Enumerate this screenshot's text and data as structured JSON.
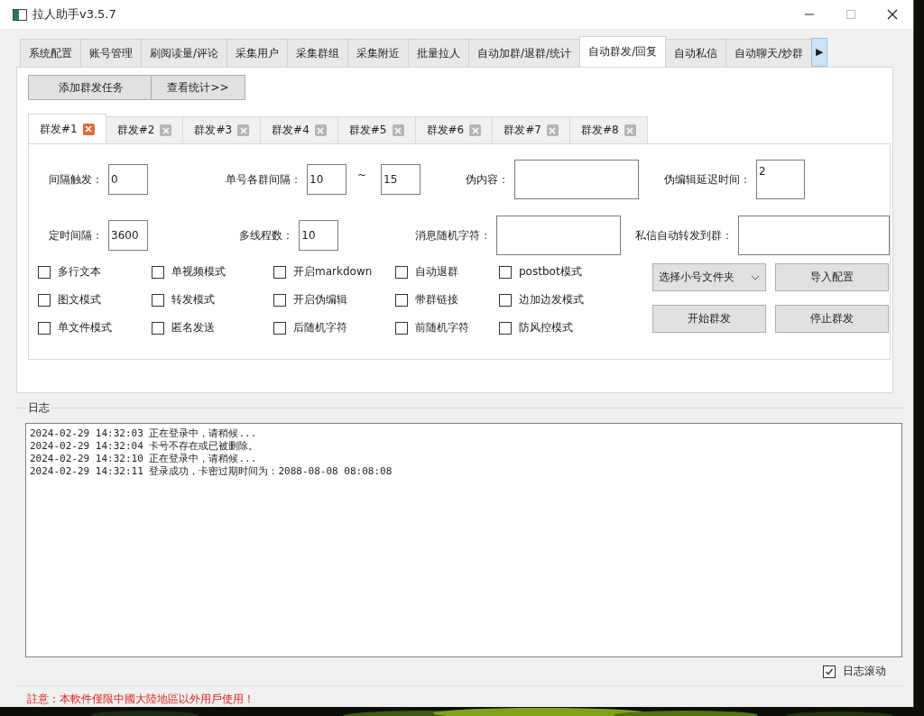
{
  "window": {
    "title": "拉人助手v3.5.7"
  },
  "main_tabs": [
    {
      "label": "系统配置",
      "selected": false
    },
    {
      "label": "账号管理",
      "selected": false
    },
    {
      "label": "刷阅读量/评论",
      "selected": false
    },
    {
      "label": "采集用户",
      "selected": false
    },
    {
      "label": "采集群组",
      "selected": false
    },
    {
      "label": "采集附近",
      "selected": false
    },
    {
      "label": "批量拉人",
      "selected": false
    },
    {
      "label": "自动加群/退群/统计",
      "selected": false
    },
    {
      "label": "自动群发/回复",
      "selected": true
    },
    {
      "label": "自动私信",
      "selected": false
    },
    {
      "label": "自动聊天/炒群",
      "selected": false
    }
  ],
  "tab_scroll": "▶",
  "top_buttons": [
    "添加群发任务",
    "查看统计>>"
  ],
  "sub_tabs": [
    {
      "label": "群发#1",
      "selected": true
    },
    {
      "label": "群发#2",
      "selected": false
    },
    {
      "label": "群发#3",
      "selected": false
    },
    {
      "label": "群发#4",
      "selected": false
    },
    {
      "label": "群发#5",
      "selected": false
    },
    {
      "label": "群发#6",
      "selected": false
    },
    {
      "label": "群发#7",
      "selected": false
    },
    {
      "label": "群发#8",
      "selected": false
    }
  ],
  "field_rows": [
    [
      {
        "kind": "short",
        "label": "间隔触发：",
        "value": "0"
      },
      {
        "kind": "range",
        "label": "单号各群间隔：",
        "from": "10",
        "separator": "~",
        "to": "15"
      },
      {
        "kind": "wide",
        "label": "伪内容："
      },
      {
        "kind": "tall",
        "label": "伪编辑延迟时间：",
        "value": "2"
      }
    ],
    [
      {
        "kind": "short",
        "label": "定时间隔：",
        "value": "3600"
      },
      {
        "kind": "single",
        "label": "多线程数：",
        "value": "10"
      },
      {
        "kind": "wide",
        "label": "消息随机字符："
      },
      {
        "kind": "long",
        "label": "私信自动转发到群："
      }
    ]
  ],
  "checkboxes": [
    {
      "label": "多行文本",
      "checked": false
    },
    {
      "label": "单视频模式",
      "checked": false
    },
    {
      "label": "开启markdown",
      "checked": false
    },
    {
      "label": "自动退群",
      "checked": false
    },
    {
      "label": "postbot模式",
      "checked": false
    },
    {
      "label": "图文模式",
      "checked": false
    },
    {
      "label": "转发模式",
      "checked": false
    },
    {
      "label": "开启伪编辑",
      "checked": false
    },
    {
      "label": "带群链接",
      "checked": false
    },
    {
      "label": "边加边发模式",
      "checked": false
    },
    {
      "label": "单文件模式",
      "checked": false
    },
    {
      "label": "匿名发送",
      "checked": false
    },
    {
      "label": "后随机字符",
      "checked": false
    },
    {
      "label": "前随机字符",
      "checked": false
    },
    {
      "label": "防风控模式",
      "checked": false
    }
  ],
  "folder_dropdown": {
    "value": "选择小号文件夹"
  },
  "action_buttons": [
    "导入配置",
    "开始群发",
    "停止群发"
  ],
  "log": {
    "title": "日志",
    "lines": [
      "2024-02-29 14:32:03 正在登录中，请稍候...",
      "2024-02-29 14:32:04 卡号不存在或已被删除。",
      "2024-02-29 14:32:10 正在登录中，请稍候...",
      "2024-02-29 14:32:11 登录成功，卡密过期时间为：2088-08-08 08:08:08"
    ],
    "autoscroll": {
      "label": "日志滚动",
      "checked": true
    }
  },
  "notice": "註意：本軟件僅限中國大陸地區以外用戶使用！",
  "desktop": {
    "kind": "picture"
  }
}
